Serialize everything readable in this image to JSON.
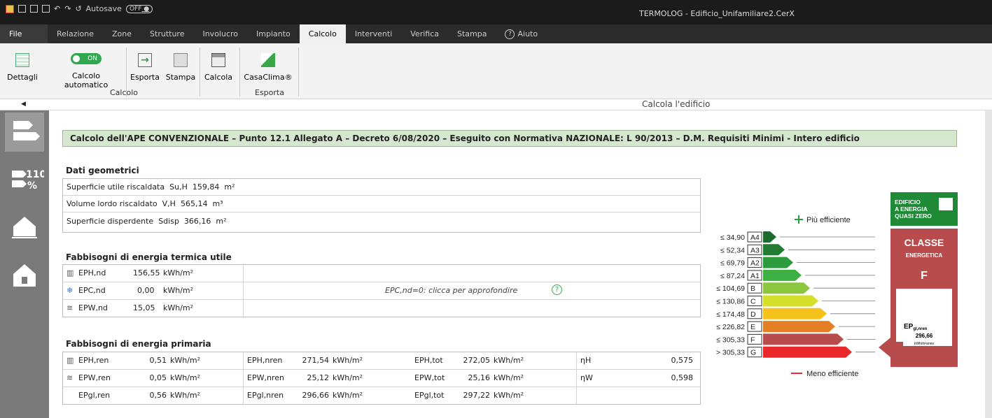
{
  "titlebar": {
    "autosave": "Autosave",
    "autosave_state": "OFF",
    "app_title": "TERMOLOG - Edificio_Unifamiliare2.CerX"
  },
  "tabs": [
    "File",
    "Relazione",
    "Zone",
    "Strutture",
    "Involucro",
    "Impianto",
    "Calcolo",
    "Interventi",
    "Verifica",
    "Stampa",
    "Aiuto"
  ],
  "active_tab": "Calcolo",
  "ribbon": {
    "dettagli": "Dettagli",
    "toggle": "ON",
    "calcolo_automatico": "Calcolo automatico",
    "esporta": "Esporta",
    "stampa": "Stampa",
    "calcola": "Calcola",
    "casaclima": "CasaClima®",
    "group_calcolo": "Calcolo",
    "group_esporta": "Esporta"
  },
  "content_title": "Calcola l'edificio",
  "banner": "Calcolo dell'APE CONVENZIONALE – Punto 12.1 Allegato A – Decreto 6/08/2020 – Eseguito con Normativa NAZIONALE: L 90/2013 – D.M. Requisiti Minimi - Intero edificio",
  "geo": {
    "title": "Dati geometrici",
    "rows": [
      {
        "label": "Superficie utile riscaldata",
        "sym": "Su,H",
        "val": "159,84",
        "unit": "m²"
      },
      {
        "label": "Volume lordo riscaldato",
        "sym": "V,H",
        "val": "565,14",
        "unit": "m³"
      },
      {
        "label": "Superficie disperdente",
        "sym": "Sdisp",
        "val": "366,16",
        "unit": "m²"
      }
    ]
  },
  "termica": {
    "title": "Fabbisogni di energia termica utile",
    "rows": [
      {
        "label": "EPH,nd",
        "val": "156,55",
        "unit": "kWh/m²"
      },
      {
        "label": "EPC,nd",
        "val": "0,00",
        "unit": "kWh/m²"
      },
      {
        "label": "EPW,nd",
        "val": "15,05",
        "unit": "kWh/m²"
      }
    ],
    "note": "EPC,nd=0: clicca per approfondire"
  },
  "primaria": {
    "title": "Fabbisogni di energia primaria",
    "rows": [
      {
        "c1": "EPH,ren",
        "v1": "0,51",
        "u1": "kWh/m²",
        "c2": "EPH,nren",
        "v2": "271,54",
        "u2": "kWh/m²",
        "c3": "EPH,tot",
        "v3": "272,05",
        "u3": "kWh/m²",
        "c4": "ηH",
        "v4": "0,575"
      },
      {
        "c1": "EPW,ren",
        "v1": "0,05",
        "u1": "kWh/m²",
        "c2": "EPW,nren",
        "v2": "25,12",
        "u2": "kWh/m²",
        "c3": "EPW,tot",
        "v3": "25,16",
        "u3": "kWh/m²",
        "c4": "ηW",
        "v4": "0,598"
      },
      {
        "c1": "EPgl,ren",
        "v1": "0,56",
        "u1": "kWh/m²",
        "c2": "EPgl,nren",
        "v2": "296,66",
        "u2": "kWh/m²",
        "c3": "EPgl,tot",
        "v3": "297,22",
        "u3": "kWh/m²",
        "c4": "",
        "v4": ""
      }
    ]
  },
  "scale": {
    "more": "Più efficiente",
    "less": "Meno efficiente",
    "classes": [
      {
        "limit": "≤ 34,90",
        "cls": "A4",
        "color": "#1e6b2e"
      },
      {
        "limit": "≤ 52,34",
        "cls": "A3",
        "color": "#237a31"
      },
      {
        "limit": "≤ 69,79",
        "cls": "A2",
        "color": "#2e9a3e"
      },
      {
        "limit": "≤ 87,24",
        "cls": "A1",
        "color": "#3cb043"
      },
      {
        "limit": "≤ 104,69",
        "cls": "B",
        "color": "#8cc63f"
      },
      {
        "limit": "≤ 130,86",
        "cls": "C",
        "color": "#d6e02a"
      },
      {
        "limit": "≤ 174,48",
        "cls": "D",
        "color": "#f4c21b"
      },
      {
        "limit": "≤ 226,82",
        "cls": "E",
        "color": "#e57f26"
      },
      {
        "limit": "≤ 305,33",
        "cls": "F",
        "color": "#b84c4c"
      },
      {
        "limit": "> 305,33",
        "cls": "G",
        "color": "#e8282b"
      }
    ]
  },
  "badge": {
    "nzeb_l1": "EDIFICIO",
    "nzeb_l2": "A ENERGIA",
    "nzeb_l3": "QUASI ZERO",
    "classe": "CLASSE",
    "energetica": "ENERGETICA",
    "letter": "F",
    "ep": "EP",
    "ep_sub": "gl,nren",
    "ep_val": "296,66",
    "ep_unit": "kWh/m²anno"
  }
}
